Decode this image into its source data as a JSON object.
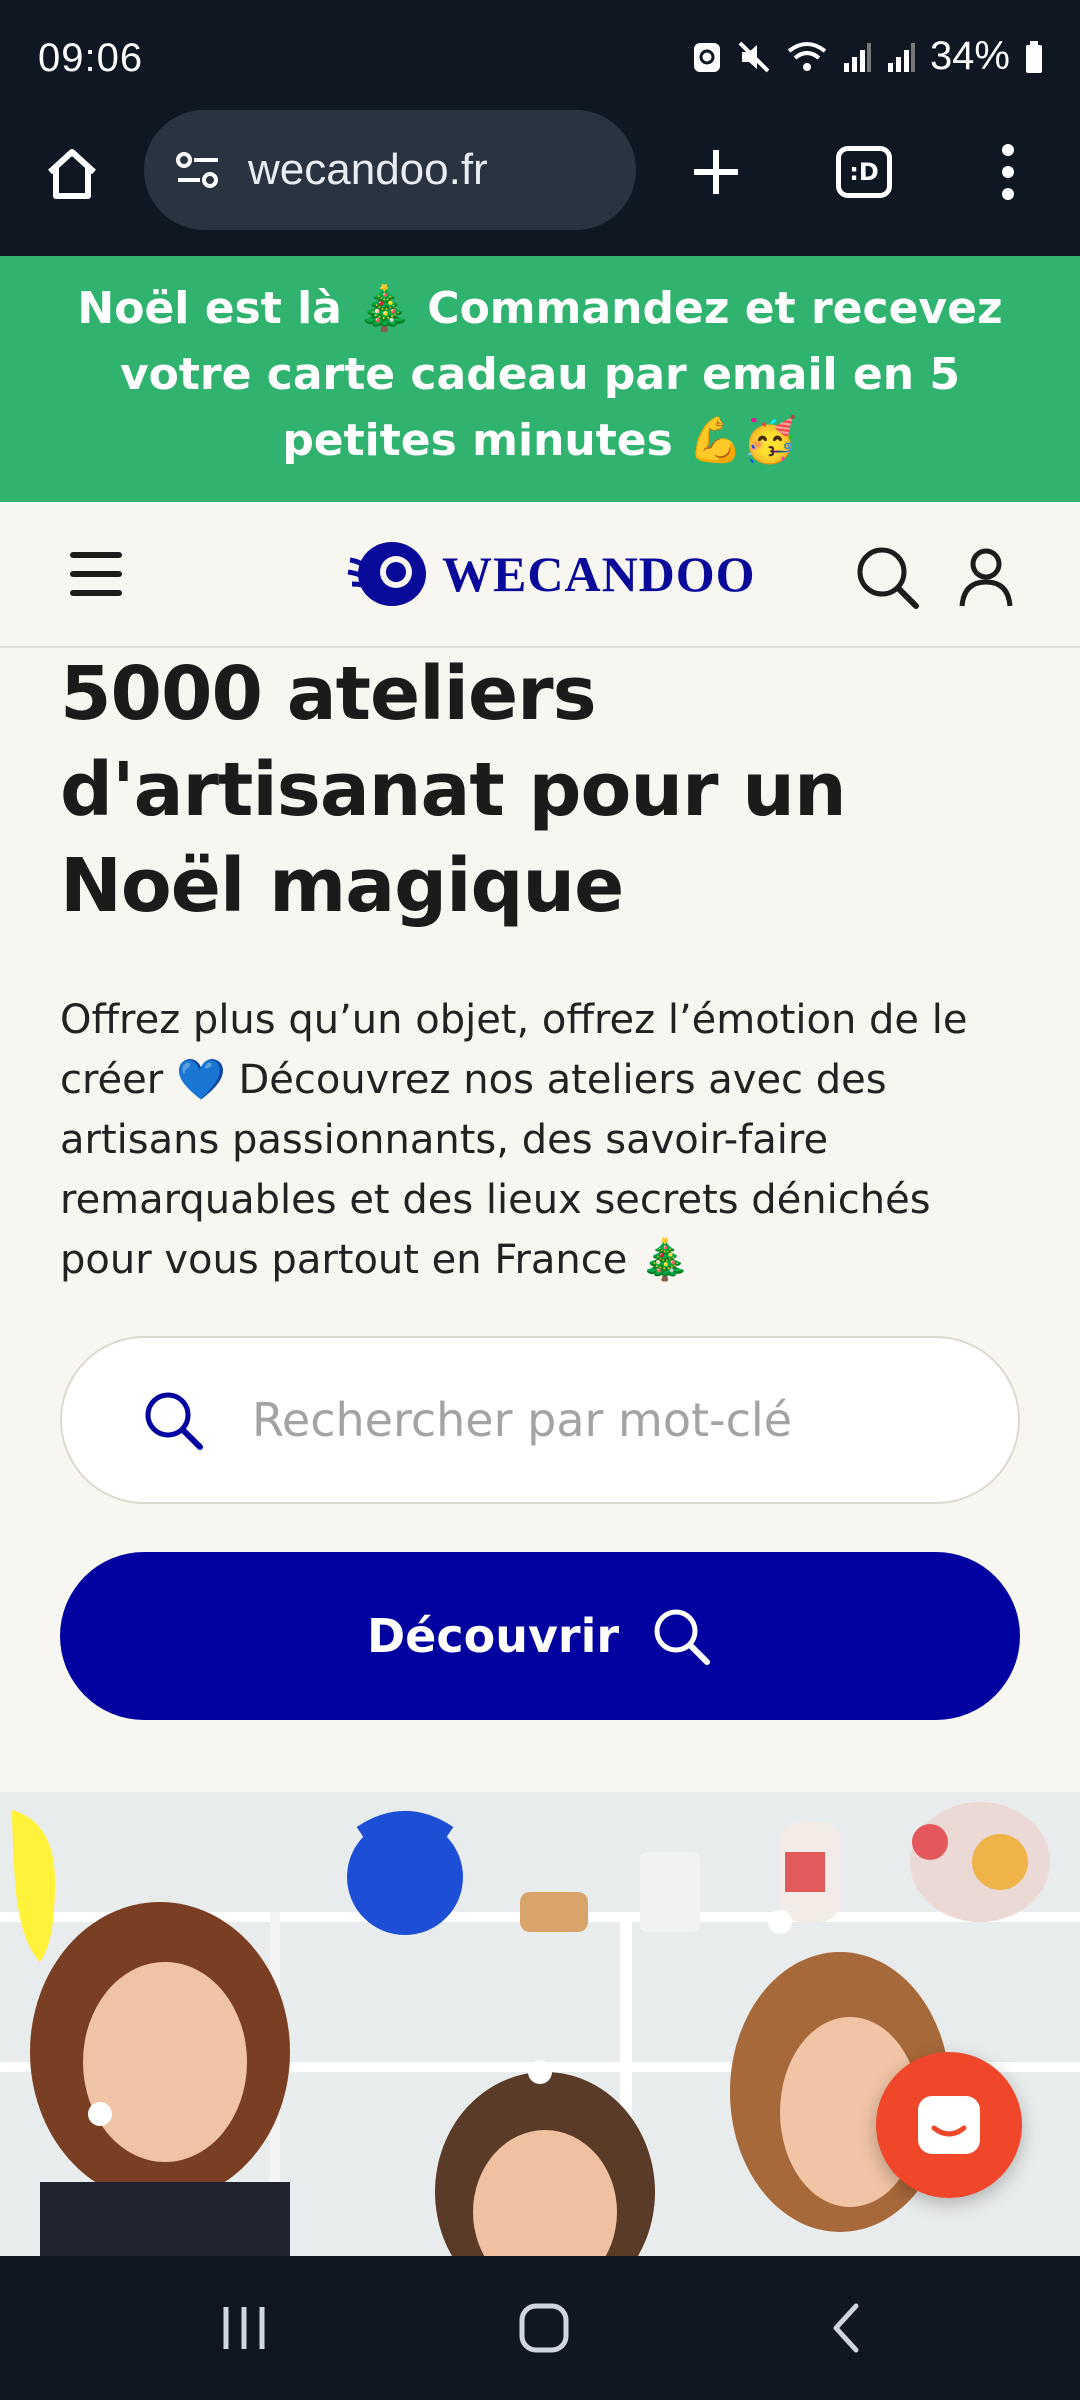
{
  "status_bar": {
    "time": "09:06",
    "battery": "34%",
    "icons": [
      "battery-saver-icon",
      "mute-icon",
      "wifi-icon",
      "signal-icon",
      "signal-icon",
      "battery-icon"
    ]
  },
  "browser": {
    "url": "wecandoo.fr",
    "tabs_label": ":D",
    "icons": [
      "home-icon",
      "site-settings-icon",
      "plus-icon",
      "tabs-icon",
      "more-vert-icon"
    ]
  },
  "promo": {
    "text": "Noël est là 🎄 Commandez et recevez votre carte cadeau par email en 5 petites minutes 💪🥳"
  },
  "site_nav": {
    "logo_text": "WECANDOO",
    "icons": [
      "menu-icon",
      "logo-icon",
      "search-icon",
      "user-icon"
    ]
  },
  "hero": {
    "title": "5000 ateliers d'artisanat pour un Noël magique",
    "description": "Offrez plus qu’un objet, offrez l’émotion de le créer 💙 Découvrez nos ateliers avec des artisans passionnants, des savoir-faire remarquables et des lieux secrets dénichés pour vous partout en France 🎄",
    "search_placeholder": "Rechercher par mot-clé",
    "cta_label": "Découvrir"
  },
  "colors": {
    "promo_bg": "#2fb36f",
    "brand_blue": "#0202a0",
    "page_bg": "#f8f6f1",
    "chat_bubble": "#f0462a",
    "system_bar": "#0f1722"
  },
  "floating": {
    "icon": "chat-bubble-icon"
  },
  "system_nav": {
    "icons": [
      "recent-apps-icon",
      "home-circle-icon",
      "back-icon"
    ]
  }
}
